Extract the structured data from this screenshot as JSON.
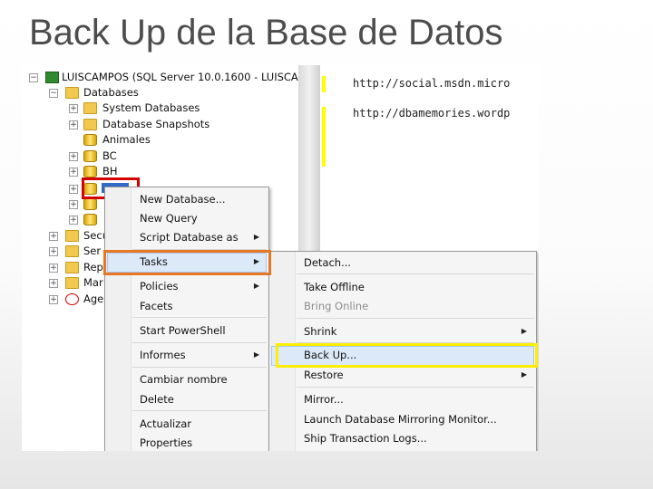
{
  "slide": {
    "title": "Back Up de la Base de Datos"
  },
  "tree": {
    "server_label": "LUISCAMPOS (SQL Server 10.0.1600 - LUISCAI",
    "databases_label": "Databases",
    "system_databases_label": "System Databases",
    "snapshots_label": "Database Snapshots",
    "db_animales": "Animales",
    "db_bc": "BC",
    "db_bh": "BH",
    "security_label": "Secu",
    "server_objects_label": "Ser",
    "replication_label": "Rep",
    "management_label": "Mar",
    "agent_label": "Age"
  },
  "code": {
    "line1": "http://social.msdn.micro",
    "line2": "http://dbamemories.wordp"
  },
  "context_menu": {
    "new_database": "New Database...",
    "new_query": "New Query",
    "script_database_as": "Script Database as",
    "tasks": "Tasks",
    "policies": "Policies",
    "facets": "Facets",
    "start_powershell": "Start PowerShell",
    "informes": "Informes",
    "cambiar_nombre": "Cambiar nombre",
    "delete": "Delete",
    "actualizar": "Actualizar",
    "properties": "Properties"
  },
  "tasks_menu": {
    "detach": "Detach...",
    "take_offline": "Take Offline",
    "bring_online": "Bring Online",
    "shrink": "Shrink",
    "back_up": "Back Up...",
    "restore": "Restore",
    "mirror": "Mirror...",
    "launch_mirroring_monitor": "Launch Database Mirroring Monitor...",
    "ship_transaction_logs": "Ship Transaction Logs..."
  },
  "colors": {
    "highlight_tasks": "#e87722",
    "highlight_database": "#d40000",
    "highlight_backup": "#ffee00",
    "code_margin": "#ffff00"
  },
  "icons": {
    "submenu_arrow": "▶",
    "expand": "+",
    "collapse": "−"
  }
}
